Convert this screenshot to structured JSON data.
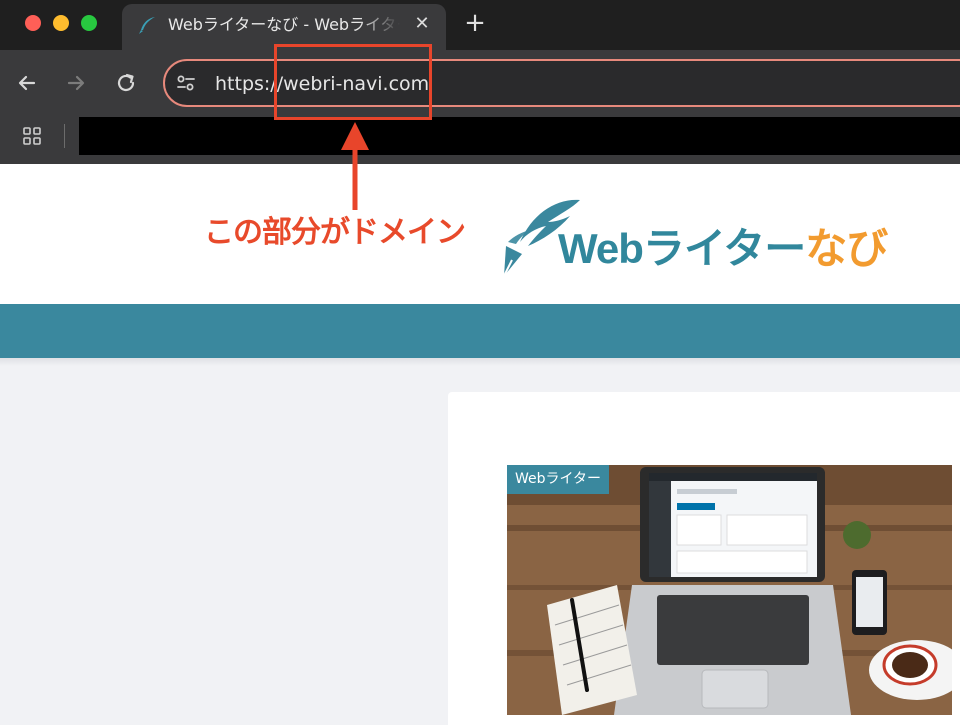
{
  "window": {
    "tab": {
      "title": "Webライターなび - Webライターなび",
      "favicon": "quill-pen-icon"
    },
    "controls": [
      "close-window",
      "minimize-window",
      "zoom-window"
    ],
    "new_tab_label": "+",
    "tab_close_label": "✕"
  },
  "toolbar": {
    "back_icon": "arrow-left-icon",
    "forward_icon": "arrow-right-icon",
    "reload_icon": "reload-icon",
    "site_info_icon": "tune-icon",
    "url": "https://webri-navi.com"
  },
  "bookmarks": {
    "apps_icon": "apps-grid-icon"
  },
  "annotation": {
    "text": "この部分がドメイン",
    "color": "#e8452b"
  },
  "site": {
    "logo": {
      "part_a": "Webライター",
      "part_b": "なび",
      "color_a": "#31879c",
      "color_b": "#f29b2f"
    },
    "nav_color": "#3a889e",
    "post": {
      "category": "Webライター"
    }
  }
}
